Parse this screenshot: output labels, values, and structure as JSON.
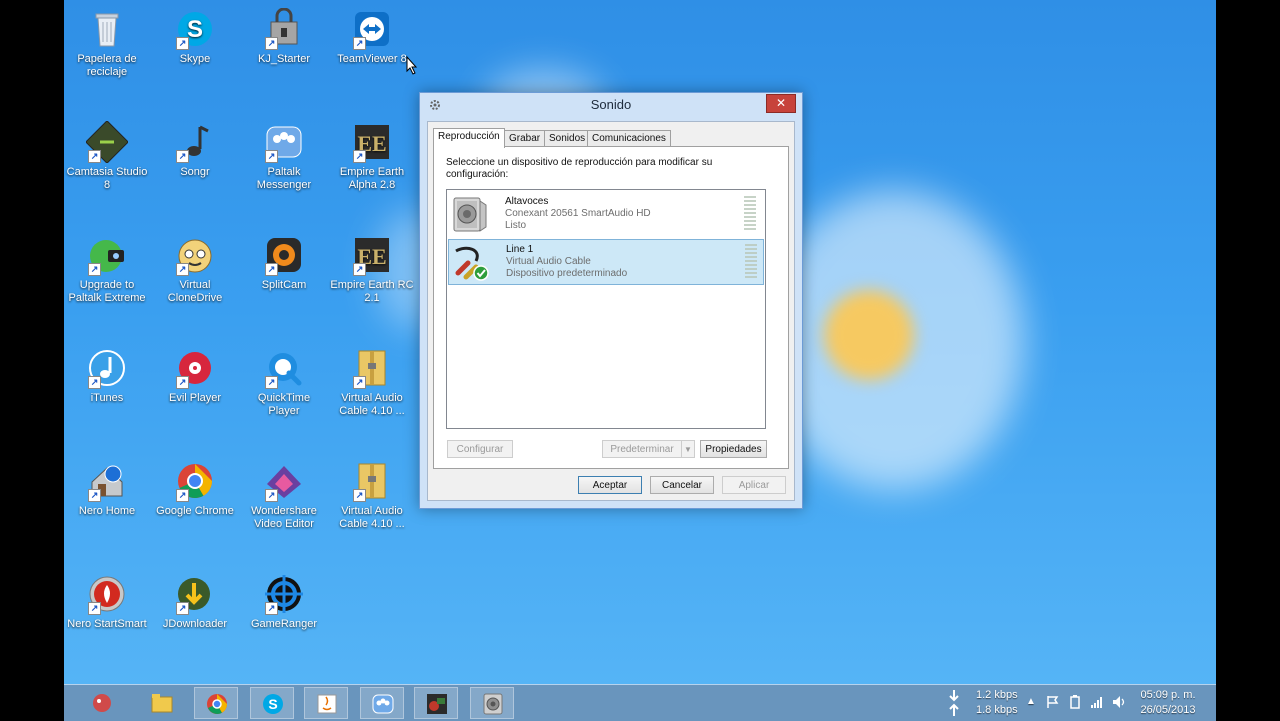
{
  "desktop_icons": [
    {
      "label": "Papelera de reciclaje",
      "icon": "recycle-bin-icon"
    },
    {
      "label": "Skype",
      "icon": "skype-icon"
    },
    {
      "label": "KJ_Starter",
      "icon": "kj-starter-icon"
    },
    {
      "label": "TeamViewer 8",
      "icon": "teamviewer-icon"
    },
    {
      "label": "Camtasia Studio 8",
      "icon": "camtasia-icon"
    },
    {
      "label": "Songr",
      "icon": "songr-icon"
    },
    {
      "label": "Paltalk Messenger",
      "icon": "paltalk-icon"
    },
    {
      "label": "Empire Earth Alpha 2.8",
      "icon": "empire-earth-icon"
    },
    {
      "label": "Upgrade to Paltalk Extreme",
      "icon": "paltalk-extreme-icon"
    },
    {
      "label": "Virtual CloneDrive",
      "icon": "clonedrive-icon"
    },
    {
      "label": "SplitCam",
      "icon": "splitcam-icon"
    },
    {
      "label": "Empire Earth RC 2.1",
      "icon": "empire-earth-rc-icon"
    },
    {
      "label": "iTunes",
      "icon": "itunes-icon"
    },
    {
      "label": "Evil Player",
      "icon": "evil-player-icon"
    },
    {
      "label": "QuickTime Player",
      "icon": "quicktime-icon"
    },
    {
      "label": "Virtual Audio Cable 4.10 ...",
      "icon": "zip-folder-icon"
    },
    {
      "label": "Nero Home",
      "icon": "nero-home-icon"
    },
    {
      "label": "Google Chrome",
      "icon": "chrome-icon"
    },
    {
      "label": "Wondershare Video Editor",
      "icon": "wondershare-icon"
    },
    {
      "label": "Virtual Audio Cable 4.10 ...",
      "icon": "zip-folder-icon"
    },
    {
      "label": "Nero StartSmart",
      "icon": "nero-startsmart-icon"
    },
    {
      "label": "JDownloader",
      "icon": "jdownloader-icon"
    },
    {
      "label": "GameRanger",
      "icon": "gameranger-icon"
    }
  ],
  "dialog": {
    "title": "Sonido",
    "close": "✕",
    "tabs": [
      "Reproducción",
      "Grabar",
      "Sonidos",
      "Comunicaciones"
    ],
    "active_tab": 0,
    "instruction": "Seleccione un dispositivo de reproducción para modificar su configuración:",
    "devices": [
      {
        "name": "Altavoces",
        "driver": "Conexant 20561 SmartAudio HD",
        "status": "Listo",
        "icon": "speaker-icon",
        "selected": false
      },
      {
        "name": "Line 1",
        "driver": "Virtual Audio Cable",
        "status": "Dispositivo predeterminado",
        "icon": "audio-cable-icon",
        "selected": true
      }
    ],
    "buttons": {
      "configure": "Configurar",
      "set_default": "Predeterminar",
      "properties": "Propiedades",
      "ok": "Aceptar",
      "cancel": "Cancelar",
      "apply": "Aplicar"
    }
  },
  "taskbar": {
    "items": [
      "start-icon",
      "file-explorer-icon",
      "chrome-icon",
      "skype-icon",
      "java-icon",
      "paltalk-icon",
      "empire-earth-icon",
      "sound-icon"
    ],
    "net_down": "1.2 kbps",
    "net_up": "1.8 kbps",
    "time": "05:09 p. m.",
    "date": "26/05/2013"
  }
}
